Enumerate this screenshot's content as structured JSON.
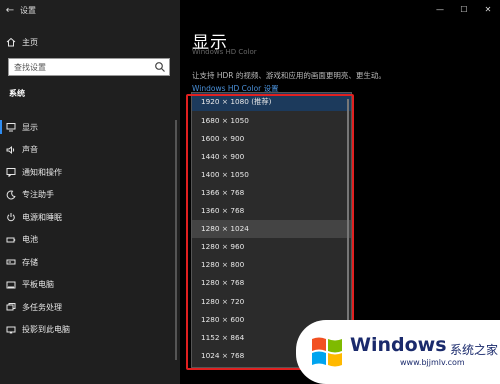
{
  "window": {
    "title": "设置",
    "controls": {
      "minimize": "—",
      "maximize": "☐",
      "close": "✕"
    }
  },
  "sidebar": {
    "home_label": "主页",
    "search_placeholder": "查找设置",
    "group_title": "系统",
    "items": [
      {
        "label": "显示",
        "icon": "monitor-icon",
        "active": true
      },
      {
        "label": "声音",
        "icon": "speaker-icon"
      },
      {
        "label": "通知和操作",
        "icon": "notification-icon"
      },
      {
        "label": "专注助手",
        "icon": "moon-icon"
      },
      {
        "label": "电源和睡眠",
        "icon": "power-icon"
      },
      {
        "label": "电池",
        "icon": "battery-icon"
      },
      {
        "label": "存储",
        "icon": "storage-icon"
      },
      {
        "label": "平板电脑",
        "icon": "tablet-icon"
      },
      {
        "label": "多任务处理",
        "icon": "multitask-icon"
      },
      {
        "label": "投影到此电脑",
        "icon": "project-icon"
      }
    ]
  },
  "main": {
    "title": "显示",
    "ghost_heading": "Windows HD Color",
    "hdr_text": "让支持 HDR 的视频、游戏和应用的画面更明亮、更生动。",
    "hdr_link": "Windows HD Color 设置",
    "resolutions": [
      "1920 × 1080 (推荐)",
      "1680 × 1050",
      "1600 × 900",
      "1440 × 900",
      "1400 × 1050",
      "1366 × 768",
      "1360 × 768",
      "1280 × 1024",
      "1280 × 960",
      "1280 × 800",
      "1280 × 768",
      "1280 × 720",
      "1280 × 600",
      "1152 × 864",
      "1024 × 768"
    ],
    "selected_index": 0,
    "hover_index": 7
  },
  "watermark": {
    "brand": "Windows",
    "sub": "系统之家",
    "url": "www.bjjmlv.com",
    "colors": {
      "red": "#f25022",
      "green": "#7fba00",
      "blue": "#00a4ef",
      "yellow": "#ffb900",
      "text": "#1a2a6c"
    }
  },
  "colors": {
    "accent": "#2f8cf0",
    "highlight_box": "#e02020",
    "selected_row": "#1c3a5c"
  }
}
